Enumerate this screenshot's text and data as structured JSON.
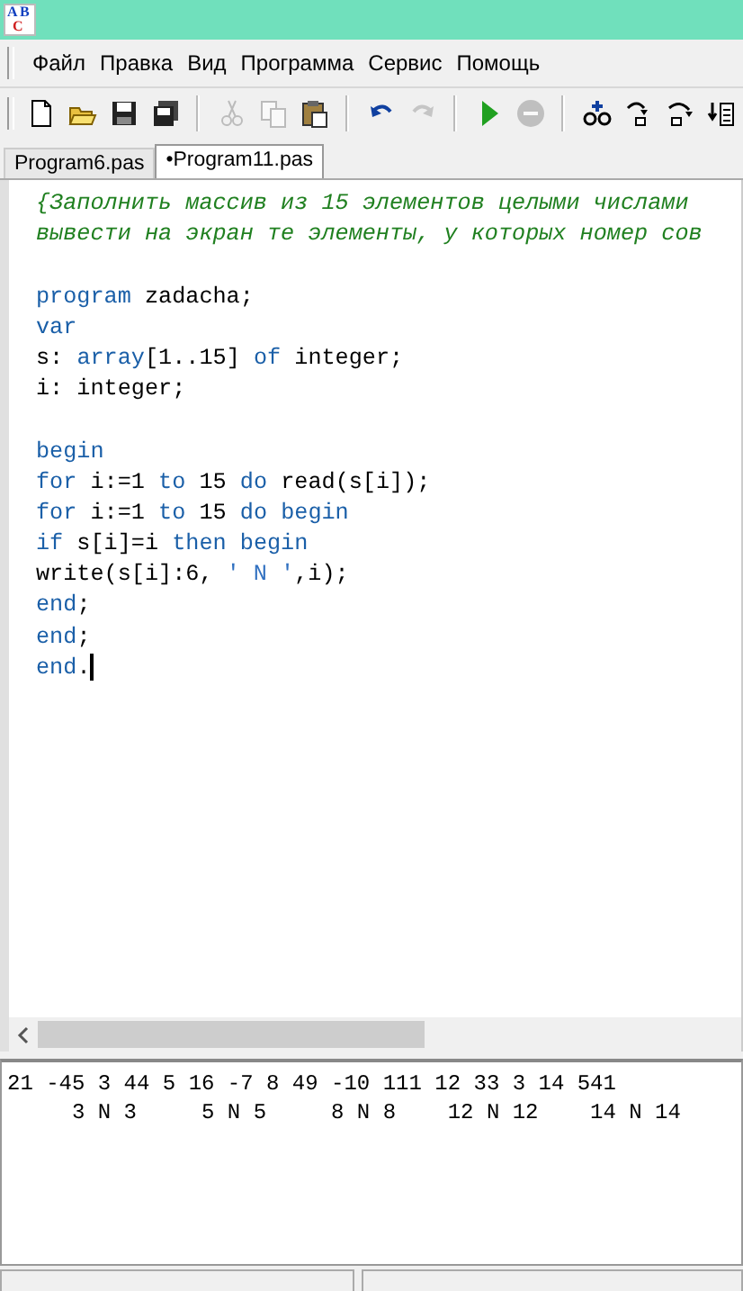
{
  "window": {
    "title_icon": "ABC"
  },
  "menu": [
    "Файл",
    "Правка",
    "Вид",
    "Программа",
    "Сервис",
    "Помощь"
  ],
  "toolbar": [
    {
      "kind": "new",
      "disabled": false
    },
    {
      "kind": "open",
      "disabled": false
    },
    {
      "kind": "save",
      "disabled": false
    },
    {
      "kind": "saveall",
      "disabled": false
    },
    {
      "kind": "sep"
    },
    {
      "kind": "cut",
      "disabled": true
    },
    {
      "kind": "copy",
      "disabled": true
    },
    {
      "kind": "paste",
      "disabled": false
    },
    {
      "kind": "sep"
    },
    {
      "kind": "undo",
      "disabled": false
    },
    {
      "kind": "redo",
      "disabled": true
    },
    {
      "kind": "sep"
    },
    {
      "kind": "run",
      "disabled": false
    },
    {
      "kind": "stop",
      "disabled": true
    },
    {
      "kind": "sep"
    },
    {
      "kind": "watch",
      "disabled": false
    },
    {
      "kind": "stepinto",
      "disabled": false
    },
    {
      "kind": "stepover",
      "disabled": false
    },
    {
      "kind": "runto",
      "disabled": false
    }
  ],
  "tabs": [
    {
      "label": "Program6.pas",
      "selected": false
    },
    {
      "label": "•Program11.pas",
      "selected": true
    }
  ],
  "editor": {
    "lines": [
      {
        "tokens": [
          {
            "kind": "comment",
            "text": "{Заполнить массив из 15 элементов целыми числами"
          }
        ]
      },
      {
        "tokens": [
          {
            "kind": "comment",
            "text": "вывести на экран те элементы, у которых номер сов"
          }
        ]
      },
      {
        "space_before": true,
        "tokens": [
          {
            "kind": "keyword",
            "text": "program"
          },
          {
            "kind": "plain",
            "text": " zadacha;"
          }
        ]
      },
      {
        "tokens": [
          {
            "kind": "keyword",
            "text": "var"
          }
        ]
      },
      {
        "tokens": [
          {
            "kind": "plain",
            "text": "s: "
          },
          {
            "kind": "keyword",
            "text": "array"
          },
          {
            "kind": "plain",
            "text": "[1..15] "
          },
          {
            "kind": "keyword",
            "text": "of"
          },
          {
            "kind": "plain",
            "text": " integer;"
          }
        ]
      },
      {
        "tokens": [
          {
            "kind": "plain",
            "text": "i: integer;"
          }
        ]
      },
      {
        "space_before": true,
        "tokens": [
          {
            "kind": "keyword",
            "text": "begin"
          }
        ]
      },
      {
        "tokens": [
          {
            "kind": "keyword",
            "text": "for"
          },
          {
            "kind": "plain",
            "text": " i:=1 "
          },
          {
            "kind": "keyword",
            "text": "to"
          },
          {
            "kind": "plain",
            "text": " 15 "
          },
          {
            "kind": "keyword",
            "text": "do"
          },
          {
            "kind": "plain",
            "text": " read(s[i]);"
          }
        ]
      },
      {
        "tokens": [
          {
            "kind": "keyword",
            "text": "for"
          },
          {
            "kind": "plain",
            "text": " i:=1 "
          },
          {
            "kind": "keyword",
            "text": "to"
          },
          {
            "kind": "plain",
            "text": " 15 "
          },
          {
            "kind": "keyword",
            "text": "do begin"
          }
        ]
      },
      {
        "tokens": [
          {
            "kind": "keyword",
            "text": "if"
          },
          {
            "kind": "plain",
            "text": " s[i]=i "
          },
          {
            "kind": "keyword",
            "text": "then begin"
          }
        ]
      },
      {
        "tokens": [
          {
            "kind": "plain",
            "text": "write(s[i]:6, "
          },
          {
            "kind": "string",
            "text": "' N '"
          },
          {
            "kind": "plain",
            "text": ",i);"
          }
        ]
      },
      {
        "tokens": [
          {
            "kind": "keyword",
            "text": "end"
          },
          {
            "kind": "plain",
            "text": ";"
          }
        ]
      },
      {
        "tokens": [
          {
            "kind": "keyword",
            "text": "end"
          },
          {
            "kind": "plain",
            "text": ";"
          }
        ]
      },
      {
        "tokens": [
          {
            "kind": "keyword",
            "text": "end"
          },
          {
            "kind": "plain",
            "text": "."
          },
          {
            "kind": "cursor"
          }
        ]
      }
    ]
  },
  "output": {
    "lines": [
      "21 -45 3 44 5 16 -7 8 49 -10 111 12 33 3 14 541",
      "     3 N 3     5 N 5     8 N 8    12 N 12    14 N 14"
    ]
  }
}
